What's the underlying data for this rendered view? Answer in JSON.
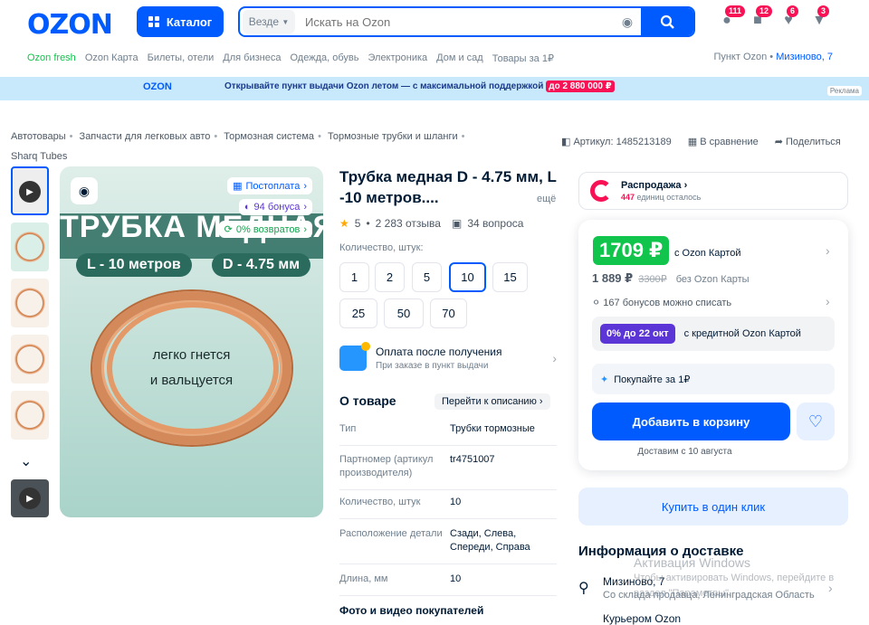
{
  "header": {
    "logo": "OZON",
    "catalog_label": "Каталог",
    "search_scope": "Везде",
    "search_placeholder": "Искать на Ozon",
    "badges": [
      "111",
      "12",
      "6",
      "3"
    ]
  },
  "nav": {
    "items": [
      "Ozon fresh",
      "Ozon Карта",
      "Билеты, отели",
      "Для бизнеса",
      "Одежда, обувь",
      "Электроника",
      "Дом и сад",
      "Товары за 1₽"
    ],
    "pickup_label": "Пункт Ozon •",
    "pickup_address": "Мизиново, 7"
  },
  "banner": {
    "logo": "OZON",
    "text": "Открывайте пункт выдачи Ozon летом — с максимальной поддержкой",
    "promo": "до 2 880 000 ₽",
    "ad": "Реклама"
  },
  "breadcrumbs": [
    "Автотовары",
    "Запчасти для легковых авто",
    "Тормозная система",
    "Тормозные трубки и шланги",
    "Sharq Tubes"
  ],
  "meta": {
    "article": "Артикул: 1485213189",
    "compare": "В сравнение",
    "share": "Поделиться"
  },
  "gallery": {
    "postpay": "Постоплата",
    "bonus": "94 бонуса",
    "returns": "0% возвратов",
    "headline": "ТРУБКА МЕДНАЯ",
    "length_pill": "L - 10 метров",
    "diameter_pill": "D - 4.75 мм",
    "caption1": "легко гнется",
    "caption2": "и вальцуется"
  },
  "product": {
    "title": "Трубка медная D - 4.75 мм, L -10 метров....",
    "more": "ещё",
    "rating": "5",
    "reviews": "2 283 отзыва",
    "questions": "34 вопроса",
    "qty_label": "Количество, штук:",
    "qty_options": [
      "1",
      "2",
      "5",
      "10",
      "15",
      "25",
      "50",
      "70"
    ],
    "qty_selected": "10",
    "payment_title": "Оплата после получения",
    "payment_sub": "При заказе в пункт выдачи",
    "about_title": "О товаре",
    "to_description": "Перейти к описанию",
    "attributes": [
      {
        "k": "Тип",
        "v": "Трубки тормозные"
      },
      {
        "k": "Партномер (артикул производителя)",
        "v": "tr4751007"
      },
      {
        "k": "Количество, штук",
        "v": "10"
      },
      {
        "k": "Расположение детали",
        "v": "Сзади, Слева, Спереди, Справа"
      },
      {
        "k": "Длина, мм",
        "v": "10"
      }
    ],
    "photos_title": "Фото и видео покупателей"
  },
  "sale": {
    "title": "Распродажа",
    "count": "447",
    "count_suffix": "единиц осталось"
  },
  "price": {
    "ozon_price": "1709 ₽",
    "ozon_price_label": "с Ozon Картой",
    "price": "1 889 ₽",
    "old_price": "3300₽",
    "price_label": "без Ozon Карты",
    "bonus_count": "167",
    "bonus_text": "бонусов можно списать",
    "credit_badge": "0% до 22 окт",
    "credit_text": "с кредитной Ozon Картой",
    "buy_for_1": "Покупайте за 1₽",
    "add_to_cart": "Добавить в корзину",
    "delivery_date": "Доставим с 10 августа",
    "one_click": "Купить в один клик"
  },
  "delivery": {
    "title": "Информация о доставке",
    "address": "Мизиново, 7",
    "from": "Со склада продавца, Ленинградская Область",
    "next": "Курьером Ozon"
  },
  "watermark": {
    "line1": "Активация Windows",
    "line2": "Чтобы активировать Windows, перейдите в",
    "line3": "раздел \"Параметры\"."
  },
  "colors": {
    "brand": "#005bff",
    "sale": "#f91155",
    "green": "#10c44c"
  }
}
